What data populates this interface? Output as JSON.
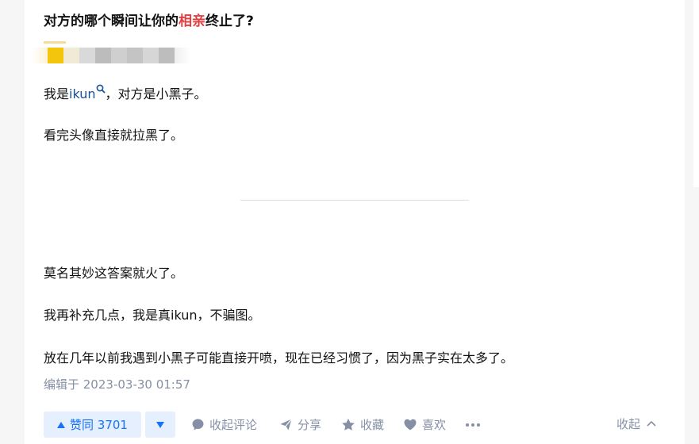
{
  "question": {
    "title_before": "对方的哪个瞬间让你的",
    "title_highlight": "相亲",
    "title_after": "终止了?"
  },
  "answer": {
    "p1_before": "我是",
    "p1_keyword": "ikun",
    "p1_after": "，对方是小黑子。",
    "p2": "看完头像直接就拉黑了。",
    "p3": "莫名其妙这答案就火了。",
    "p4": "我再补充几点，我是真ikun，不骗图。",
    "p5": "放在几年以前我遇到小黑子可能直接开喷，现在已经习惯了，因为黑子实在太多了。",
    "edited": "编辑于 2023-03-30 01:57"
  },
  "actions": {
    "upvote_label": "赞同 3701",
    "comments_label": "收起评论",
    "share_label": "分享",
    "collect_label": "收藏",
    "like_label": "喜欢",
    "collapse_label": "收起"
  },
  "colors": {
    "accent": "#1772f6",
    "highlight": "#e33e3e",
    "keyword": "#175199",
    "muted": "#8590a6"
  }
}
